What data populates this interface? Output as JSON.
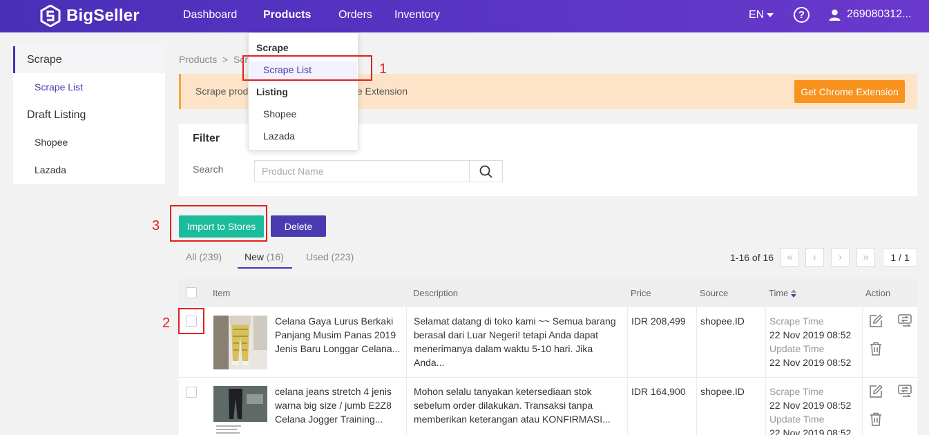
{
  "nav": {
    "brand": "BigSeller",
    "items": [
      "Dashboard",
      "Products",
      "Orders",
      "Inventory"
    ],
    "active": "Products",
    "language": "EN",
    "user": "269080312..."
  },
  "dropdown": {
    "scrape_header": "Scrape",
    "scrape_list": "Scrape List",
    "listing_header": "Listing",
    "shopee": "Shopee",
    "lazada": "Lazada"
  },
  "sidebar": {
    "scrape": "Scrape",
    "scrape_list": "Scrape List",
    "draft_listing": "Draft Listing",
    "shopee": "Shopee",
    "lazada": "Lazada"
  },
  "breadcrumb": "Products  >  Scra",
  "banner": {
    "text_visible": "Scrape prod",
    "text_tail": "r Chrome Extension",
    "button": "Get Chrome Extension"
  },
  "filter": {
    "title": "Filter",
    "search_label": "Search",
    "placeholder": "Product Name"
  },
  "actions": {
    "import": "Import to Stores",
    "delete": "Delete"
  },
  "tabs": [
    {
      "label": "All",
      "count": "(239)"
    },
    {
      "label": "New",
      "count": "(16)"
    },
    {
      "label": "Used",
      "count": "(223)"
    }
  ],
  "pagination": {
    "range": "1-16 of 16",
    "page": "1 / 1"
  },
  "table": {
    "headers": {
      "item": "Item",
      "description": "Description",
      "price": "Price",
      "source": "Source",
      "time": "Time",
      "action": "Action"
    },
    "rows": [
      {
        "title": "Celana Gaya Lurus Berkaki Panjang Musim Panas 2019 Jenis Baru Longgar Celana...",
        "description": "Selamat datang di toko kami ~~ Semua barang berasal dari Luar Negeri! tetapi Anda dapat menerimanya dalam waktu 5-10 hari. Jika Anda...",
        "price": "IDR 208,499",
        "source": "shopee.ID",
        "scrape_label": "Scrape Time",
        "scrape_time": "22 Nov 2019 08:52",
        "update_label": "Update Time",
        "update_time": "22 Nov 2019 08:52"
      },
      {
        "title": "celana jeans stretch 4 jenis warna big size / jumb E2Z8 Celana Jogger Training...",
        "description": "Mohon selalu tanyakan ketersediaan stok sebelum order dilakukan. Transaksi tanpa memberikan keterangan atau KONFIRMASI...",
        "price": "IDR 164,900",
        "source": "shopee.ID",
        "scrape_label": "Scrape Time",
        "scrape_time": "22 Nov 2019 08:52",
        "update_label": "Update Time",
        "update_time": "22 Nov 2019 08:52"
      }
    ]
  },
  "annotations": [
    "1",
    "2",
    "3"
  ],
  "colors": {
    "brand": "#4a2fb8",
    "import_button": "#1abc9c",
    "delete_button": "#4a3bb0",
    "chrome_button": "#f7931e",
    "banner_bg": "#fde4c8",
    "annotation": "#e02020"
  }
}
